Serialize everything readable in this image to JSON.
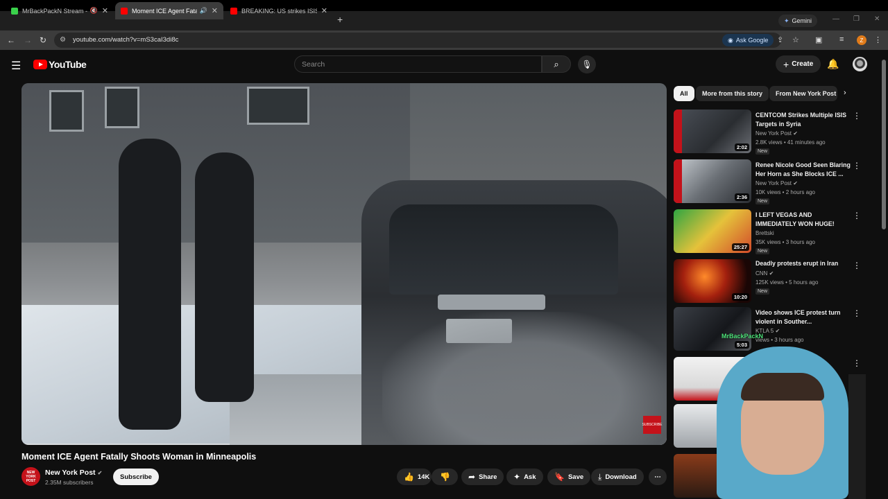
{
  "browser": {
    "tabs": [
      {
        "title": "MrBackPackN Stream - Wa",
        "favicon_color": "#3ad14b",
        "active": false
      },
      {
        "title": "Moment ICE Agent Fatally S",
        "favicon_color": "#ff0000",
        "active": true
      },
      {
        "title": "BREAKING: US strikes ISIS in Sy",
        "favicon_color": "#ff0000",
        "active": false
      }
    ],
    "new_tab": "+",
    "gemini_label": "Gemini",
    "url": "youtube.com/watch?v=mS3caI3di8c",
    "ask_google": "Ask Google",
    "profile_initial": "Z"
  },
  "youtube": {
    "logo_text": "YouTube",
    "search_placeholder": "Search",
    "create_label": "Create",
    "chips": [
      "All",
      "More from this story",
      "From New York Post"
    ],
    "video": {
      "title": "Moment ICE Agent Fatally Shoots Woman in Minneapolis",
      "channel": "New York Post",
      "channel_avatar_text": "NEW YORK POST",
      "subscribers": "2.35M subscribers",
      "subscribe_label": "Subscribe",
      "likes": "14K",
      "share_label": "Share",
      "ask_label": "Ask",
      "save_label": "Save",
      "download_label": "Download",
      "watermark": "SUBSCRIBE"
    },
    "recommendations": [
      {
        "title": "CENTCOM Strikes Multiple ISIS Targets in Syria",
        "channel": "New York Post",
        "meta": "2.8K views • 41 minutes ago",
        "duration": "2:02",
        "badge": "New"
      },
      {
        "title": "Renee Nicole Good Seen Blaring Her Horn as She Blocks ICE ...",
        "channel": "New York Post",
        "meta": "10K views • 2 hours ago",
        "duration": "2:36",
        "badge": "New"
      },
      {
        "title": "I LEFT VEGAS AND IMMEDIATELY WON HUGE!",
        "channel": "Brettski",
        "meta": "35K views • 3 hours ago",
        "duration": "25:27",
        "badge": "New"
      },
      {
        "title": "Deadly protests erupt in Iran",
        "channel": "CNN",
        "meta": "125K views • 5 hours ago",
        "duration": "10:20",
        "badge": "New"
      },
      {
        "title": "Video shows ICE protest turn violent in Souther...",
        "channel": "KTLA 5",
        "meta": "views • 3 hours ago",
        "duration": "5:03",
        "badge": ""
      }
    ],
    "overlay_text": "MrBackPackN"
  }
}
